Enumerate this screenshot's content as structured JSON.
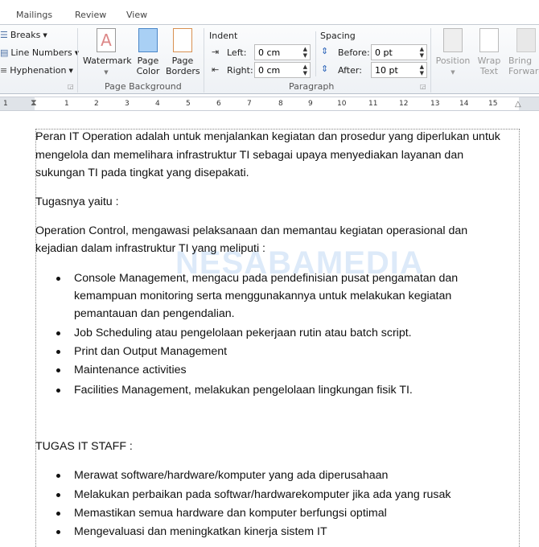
{
  "tabs": [
    "Mailings",
    "Review",
    "View"
  ],
  "ribbon": {
    "page_setup": {
      "breaks": "Breaks",
      "line_numbers": "Line Numbers",
      "hyphenation": "Hyphenation"
    },
    "page_background": {
      "label": "Page Background",
      "watermark": "Watermark",
      "page_color": [
        "Page",
        "Color"
      ],
      "page_borders": [
        "Page",
        "Borders"
      ]
    },
    "paragraph": {
      "label": "Paragraph",
      "indent": "Indent",
      "left_label": "Left:",
      "left_value": "0 cm",
      "right_label": "Right:",
      "right_value": "0 cm",
      "spacing": "Spacing",
      "before_label": "Before:",
      "before_value": "0 pt",
      "after_label": "After:",
      "after_value": "10 pt"
    },
    "arrange": {
      "position": "Position",
      "wrap": [
        "Wrap",
        "Text"
      ],
      "bring": [
        "Bring",
        "Forward"
      ]
    }
  },
  "ruler": [
    "1",
    "1",
    "2",
    "3",
    "4",
    "5",
    "6",
    "7",
    "8",
    "9",
    "10",
    "11",
    "12",
    "13",
    "14",
    "15"
  ],
  "watermark": "NESABAMEDIA",
  "doc": {
    "p1": [
      "Peran IT Operation adalah untuk menjalankan kegiatan dan prosedur yang diperlukan untuk",
      "mengelola dan memelihara infrastruktur TI sebagai upaya menyediakan layanan dan",
      "sukungan TI pada tingkat yang disepakati."
    ],
    "p2": "Tugasnya yaitu :",
    "p3": [
      "Operation Control, mengawasi pelaksanaan dan memantau kegiatan operasional dan",
      "kejadian dalam infrastruktur TI yang meliputi :"
    ],
    "list1": [
      [
        "Console Management, mengacu pada pendefinisian pusat pengamatan dan",
        "kemampuan monitoring serta menggunakannya untuk melakukan kegiatan",
        "pemantauan dan pengendalian."
      ],
      [
        "Job Scheduling atau pengelolaan pekerjaan rutin atau batch script."
      ],
      [
        "Print dan Output Management"
      ],
      [
        "Maintenance activities"
      ],
      [
        "Facilities Management, melakukan pengelolaan lingkungan fisik TI."
      ]
    ],
    "p4": "TUGAS IT STAFF :",
    "list2": [
      "Merawat software/hardware/komputer  yang ada diperusahaan",
      "Melakukan perbaikan pada softwar/hardwarekomputer  jika ada yang rusak",
      "Memastikan semua hardware dan komputer berfungsi optimal",
      "Mengevaluasi dan meningkatkan kinerja sistem IT"
    ]
  }
}
